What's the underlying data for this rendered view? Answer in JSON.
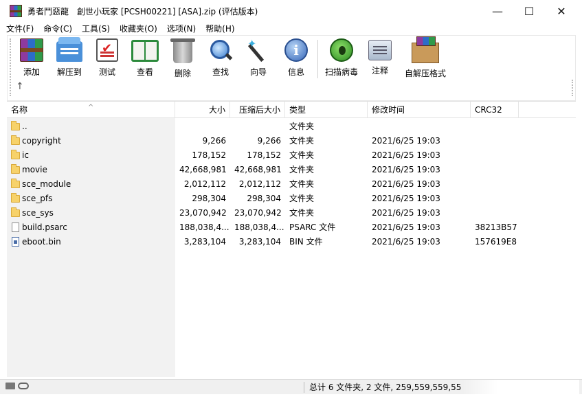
{
  "window": {
    "title": "勇者鬥惡龍　創世小玩家 [PCSH00221] [ASA].zip (评估版本)",
    "minimize": "—",
    "maximize": "☐",
    "close": "✕"
  },
  "menu": [
    "文件(F)",
    "命令(C)",
    "工具(S)",
    "收藏夹(O)",
    "选项(N)",
    "帮助(H)"
  ],
  "toolbar": {
    "add": "添加",
    "extract": "解压到",
    "test": "测试",
    "view": "查看",
    "delete": "删除",
    "find": "查找",
    "wizard": "向导",
    "info": "信息",
    "virus_scan": "扫描病毒",
    "comment": "注释",
    "sfx": "自解压格式",
    "up": "↑"
  },
  "columns": {
    "name": "名称",
    "size": "大小",
    "packed": "压缩后大小",
    "type": "类型",
    "modified": "修改时间",
    "crc": "CRC32",
    "sort_indicator": "^"
  },
  "rows": [
    {
      "name": "..",
      "size": "",
      "packed": "",
      "type": "文件夹",
      "modified": "",
      "crc": "",
      "icon": "folder-icon"
    },
    {
      "name": "copyright",
      "size": "9,266",
      "packed": "9,266",
      "type": "文件夹",
      "modified": "2021/6/25 19:03",
      "crc": "",
      "icon": "folder-icon"
    },
    {
      "name": "ic",
      "size": "178,152",
      "packed": "178,152",
      "type": "文件夹",
      "modified": "2021/6/25 19:03",
      "crc": "",
      "icon": "folder-icon"
    },
    {
      "name": "movie",
      "size": "42,668,981",
      "packed": "42,668,981",
      "type": "文件夹",
      "modified": "2021/6/25 19:03",
      "crc": "",
      "icon": "folder-icon"
    },
    {
      "name": "sce_module",
      "size": "2,012,112",
      "packed": "2,012,112",
      "type": "文件夹",
      "modified": "2021/6/25 19:03",
      "crc": "",
      "icon": "folder-icon"
    },
    {
      "name": "sce_pfs",
      "size": "298,304",
      "packed": "298,304",
      "type": "文件夹",
      "modified": "2021/6/25 19:03",
      "crc": "",
      "icon": "folder-icon"
    },
    {
      "name": "sce_sys",
      "size": "23,070,942",
      "packed": "23,070,942",
      "type": "文件夹",
      "modified": "2021/6/25 19:03",
      "crc": "",
      "icon": "folder-icon"
    },
    {
      "name": "build.psarc",
      "size": "188,038,4...",
      "packed": "188,038,4...",
      "type": "PSARC 文件",
      "modified": "2021/6/25 19:03",
      "crc": "38213B57",
      "icon": "file-icon"
    },
    {
      "name": "eboot.bin",
      "size": "3,283,104",
      "packed": "3,283,104",
      "type": "BIN 文件",
      "modified": "2021/6/25 19:03",
      "crc": "157619E8",
      "icon": "bin-file-icon"
    }
  ],
  "status": {
    "summary": "总计 6 文件夹, 2 文件, 259,559,559,55"
  }
}
